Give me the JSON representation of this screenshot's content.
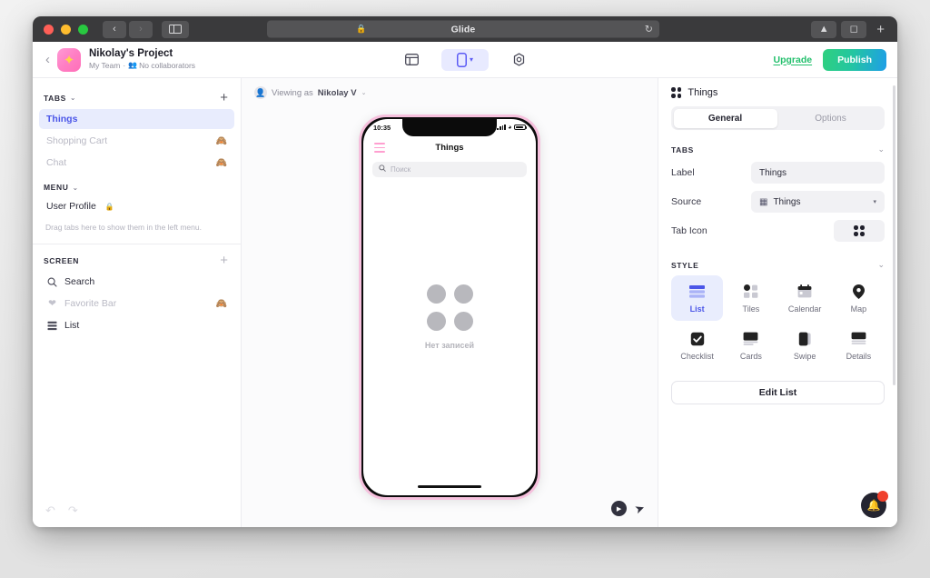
{
  "browser": {
    "url_title": "Glide",
    "lock_icon": "lock-icon",
    "reload_icon": "reload-icon",
    "back_icon": "chevron-left-icon",
    "forward_icon": "chevron-right-icon",
    "sidebar_icon": "sidebar-toggle-icon",
    "share_icon": "share-icon",
    "tabs_icon": "tabs-overview-icon",
    "new_tab_label": "+"
  },
  "header": {
    "back_label": "‹",
    "project_name": "Nikolay's Project",
    "team": "My Team",
    "separator": "·",
    "collaborators": "No collaborators",
    "tools": [
      {
        "name": "data-editor",
        "icon": "table-icon",
        "active": false
      },
      {
        "name": "layout-device",
        "icon": "phone-icon",
        "active": true
      },
      {
        "name": "settings",
        "icon": "gear-icon",
        "active": false
      }
    ],
    "upgrade_label": "Upgrade",
    "publish_label": "Publish",
    "accent_green": "#21bf6b",
    "publish_gradient_from": "#2fd07f",
    "publish_gradient_to": "#1e9ee8"
  },
  "sidebar": {
    "tabs_section": {
      "title": "TABS",
      "chevron": "⌄",
      "add_label": "+",
      "items": [
        {
          "label": "Things",
          "active": true,
          "hidden": false
        },
        {
          "label": "Shopping Cart",
          "active": false,
          "hidden": true
        },
        {
          "label": "Chat",
          "active": false,
          "hidden": true
        }
      ]
    },
    "menu_section": {
      "title": "MENU",
      "chevron": "⌄",
      "items": [
        {
          "label": "User Profile",
          "locked": true
        }
      ],
      "hint": "Drag tabs here to show them in the left menu."
    },
    "screen_section": {
      "title": "SCREEN",
      "add_label": "+",
      "items": [
        {
          "label": "Search",
          "icon": "search-icon",
          "hidden": false
        },
        {
          "label": "Favorite Bar",
          "icon": "heart-icon",
          "hidden": true
        },
        {
          "label": "List",
          "icon": "list-icon",
          "hidden": false
        }
      ]
    },
    "undo_icon": "undo-icon",
    "redo_icon": "redo-icon"
  },
  "canvas": {
    "viewing_as_prefix": "Viewing as",
    "viewing_as_user": "Nikolay V",
    "viewing_as_chevron": "⌄",
    "avatar_icon": "user-avatar-icon",
    "phone": {
      "status_time": "10:35",
      "location_icon": "location-arrow-icon",
      "signal_icon": "signal-bars-icon",
      "wifi_icon": "wifi-icon",
      "battery_icon": "battery-icon",
      "menu_icon": "hamburger-menu-icon",
      "app_title": "Things",
      "search_placeholder": "Поиск",
      "search_icon": "search-icon",
      "empty_text": "Нет записей",
      "border_color": "#f6c0dd",
      "accent_color": "#ff9fd0"
    },
    "play_icon": "play-icon",
    "cursor_icon": "cursor-pointer-icon"
  },
  "panel": {
    "title": "Things",
    "title_icon": "four-dots-icon",
    "tabs": [
      {
        "label": "General",
        "active": true
      },
      {
        "label": "Options",
        "active": false
      }
    ],
    "tabs_group": {
      "title": "TABS",
      "chevron": "⌄",
      "label_field": {
        "label": "Label",
        "value": "Things"
      },
      "source_field": {
        "label": "Source",
        "value": "Things",
        "icon": "table-source-icon",
        "caret": "▾"
      },
      "tab_icon_field": {
        "label": "Tab Icon",
        "icon": "four-dots-icon"
      }
    },
    "style_group": {
      "title": "STYLE",
      "chevron": "⌄",
      "options": [
        {
          "label": "List",
          "icon": "list-style-icon",
          "active": true
        },
        {
          "label": "Tiles",
          "icon": "tiles-style-icon",
          "active": false
        },
        {
          "label": "Calendar",
          "icon": "calendar-style-icon",
          "active": false
        },
        {
          "label": "Map",
          "icon": "map-pin-style-icon",
          "active": false
        },
        {
          "label": "Checklist",
          "icon": "checklist-style-icon",
          "active": false
        },
        {
          "label": "Cards",
          "icon": "cards-style-icon",
          "active": false
        },
        {
          "label": "Swipe",
          "icon": "swipe-style-icon",
          "active": false
        },
        {
          "label": "Details",
          "icon": "details-style-icon",
          "active": false
        }
      ]
    },
    "edit_list_label": "Edit List",
    "accent_blue": "#4b56e8",
    "notification": {
      "icon": "bell-icon",
      "badge_count": "",
      "badge_color": "#f0402c"
    }
  }
}
